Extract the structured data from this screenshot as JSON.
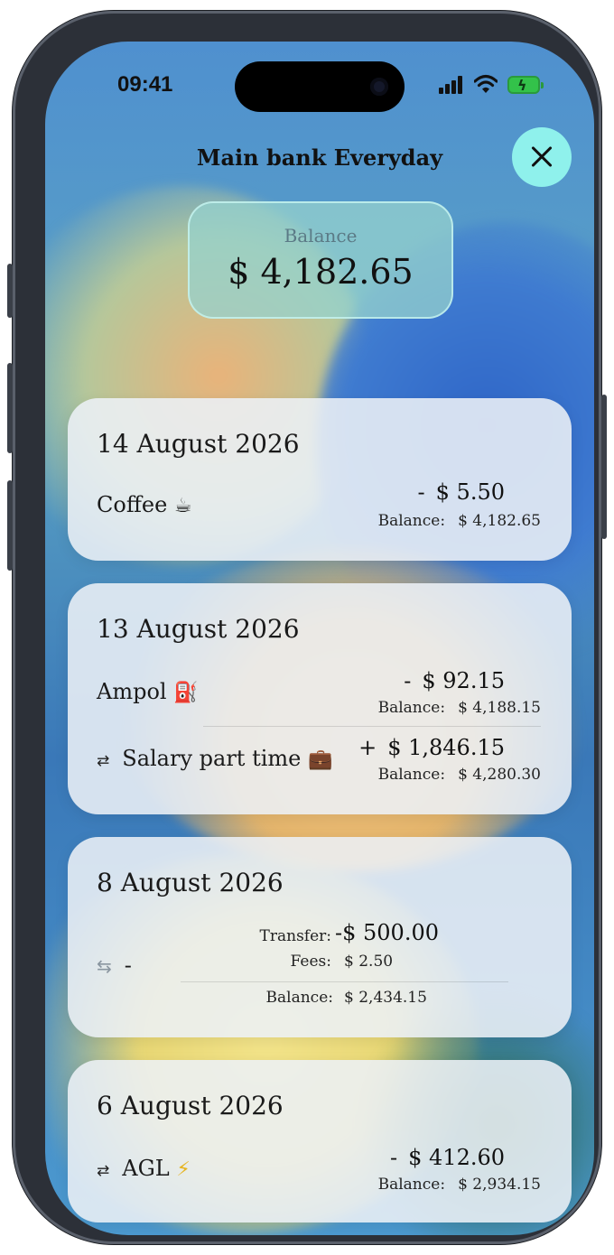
{
  "status_bar": {
    "time": "09:41"
  },
  "header": {
    "title": "Main bank Everyday"
  },
  "balance": {
    "label": "Balance",
    "value": "$ 4,182.65"
  },
  "groups": [
    {
      "date": "14 August 2026",
      "transactions": [
        {
          "name": "Coffee",
          "icon": "☕",
          "sign": "-",
          "amount": "$ 5.50",
          "balance_label": "Balance:",
          "balance": "$ 4,182.65"
        }
      ]
    },
    {
      "date": "13 August 2026",
      "transactions": [
        {
          "name": "Ampol",
          "icon": "⛽",
          "sign": "-",
          "amount": "$ 92.15",
          "balance_label": "Balance:",
          "balance": "$ 4,188.15"
        },
        {
          "name": "Salary part time",
          "icon": "💼",
          "sign": "+",
          "amount": "$ 1,846.15",
          "balance_label": "Balance:",
          "balance": "$ 4,280.30"
        }
      ]
    },
    {
      "date": "8 August 2026",
      "transfer": {
        "name": "-",
        "transfer_label": "Transfer:",
        "transfer_amount": "-$ 500.00",
        "fees_label": "Fees:",
        "fees_amount": "$ 2.50",
        "balance_label": "Balance:",
        "balance": "$ 2,434.15"
      }
    },
    {
      "date": "6 August 2026",
      "transactions": [
        {
          "name": "AGL",
          "icon": "⚡",
          "sign": "-",
          "amount": "$ 412.60",
          "balance_label": "Balance:",
          "balance": "$ 2,934.15"
        }
      ]
    }
  ]
}
